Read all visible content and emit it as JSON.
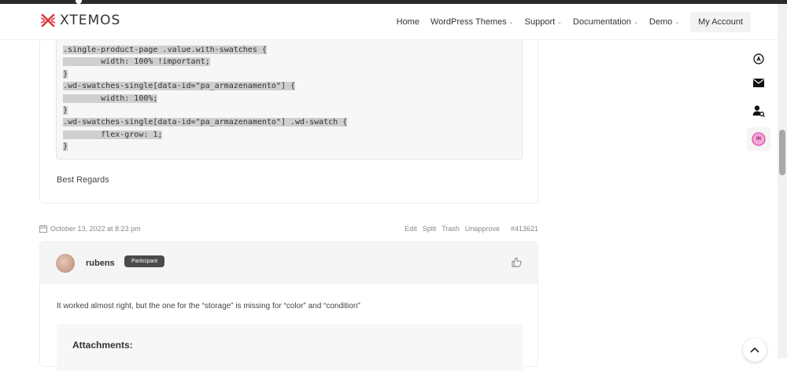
{
  "header": {
    "brand": "XTEMOS",
    "nav": [
      {
        "label": "Home",
        "dropdown": false
      },
      {
        "label": "WordPress Themes",
        "dropdown": true
      },
      {
        "label": "Support",
        "dropdown": true
      },
      {
        "label": "Documentation",
        "dropdown": true
      },
      {
        "label": "Demo",
        "dropdown": true
      }
    ],
    "account_label": "My Account"
  },
  "post1": {
    "code_lines": [
      ".single-product-page .value.with-swatches {",
      "        width: 100% !important;",
      "}",
      ".wd-swatches-single[data-id=\"pa_armazenamento\"] {",
      "        width: 100%;",
      "}",
      ".wd-swatches-single[data-id=\"pa_armazenamento\"] .wd-swatch {",
      "        flex-grow: 1;",
      "}"
    ],
    "signature": "Best Regards"
  },
  "reply_meta": {
    "date": "October 13, 2022 at 8:23 pm",
    "actions": [
      "Edit",
      "Split",
      "Trash",
      "Unapprove"
    ],
    "reply_id": "#413621"
  },
  "post2": {
    "author": "rubens",
    "role_badge": "Participant",
    "text": "It worked almost right, but the one for the “storage” is missing for “color” and “condition”",
    "attachments_title": "Attachments:"
  },
  "side_rail": {
    "icons": [
      "compass-icon",
      "mail-icon",
      "user-search-icon",
      "profile-badge-icon"
    ],
    "badge_text": "IN"
  },
  "colors": {
    "logo_accent": "#d9363e",
    "badge_bg": "#4a4a4a",
    "code_highlight": "#cfcfcf",
    "rail_badge": "#f06ec0"
  }
}
